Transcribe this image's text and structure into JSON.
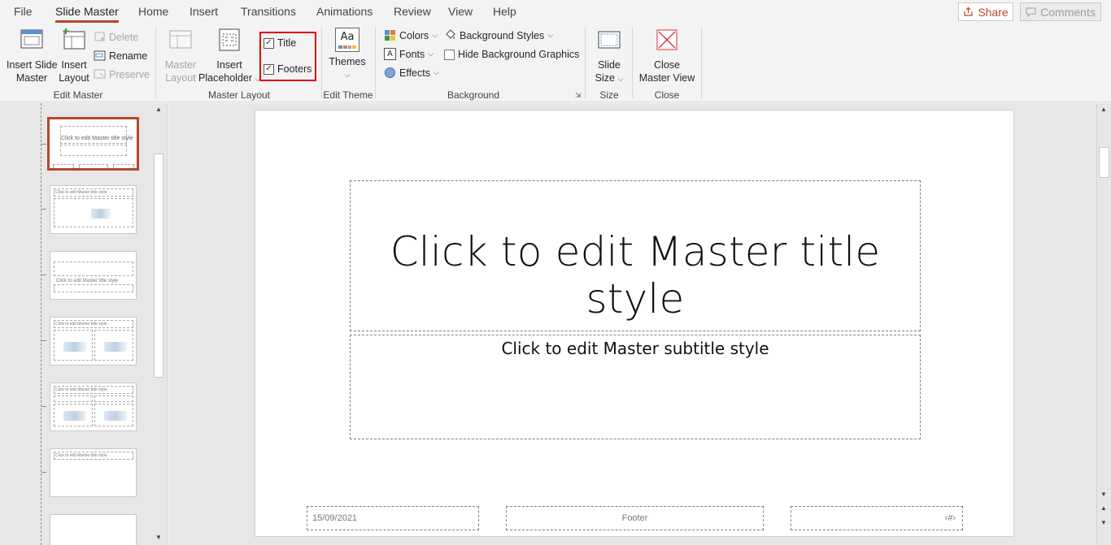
{
  "menu": {
    "tabs": [
      "File",
      "Slide Master",
      "Home",
      "Insert",
      "Transitions",
      "Animations",
      "Review",
      "View",
      "Help"
    ],
    "active_tab": "Slide Master",
    "share_label": "Share",
    "comments_label": "Comments"
  },
  "ribbon": {
    "edit_master": {
      "label": "Edit Master",
      "insert_slide_master": [
        "Insert Slide",
        "Master"
      ],
      "insert_layout": [
        "Insert",
        "Layout"
      ],
      "delete": "Delete",
      "rename": "Rename",
      "preserve": "Preserve"
    },
    "master_layout": {
      "label": "Master Layout",
      "master_layout_btn": [
        "Master",
        "Layout"
      ],
      "insert_placeholder": [
        "Insert",
        "Placeholder"
      ],
      "title_chk": "Title",
      "footers_chk": "Footers",
      "title_checked": true,
      "footers_checked": true
    },
    "edit_theme": {
      "label": "Edit Theme",
      "themes": "Themes",
      "themes_icon_text": "Aa"
    },
    "background": {
      "label": "Background",
      "colors": "Colors",
      "fonts": "Fonts",
      "effects": "Effects",
      "background_styles": "Background Styles",
      "hide_bg_graphics": "Hide Background Graphics",
      "hide_bg_checked": false
    },
    "size": {
      "label": "Size",
      "slide_size": [
        "Slide",
        "Size"
      ]
    },
    "close": {
      "label": "Close",
      "close_master_view": [
        "Close",
        "Master View"
      ]
    }
  },
  "thumbnails": {
    "master_title": "Click to edit Master title style",
    "layout_title": "Click to edit Master title style"
  },
  "slide": {
    "title": "Click to edit Master title style",
    "subtitle": "Click to edit Master subtitle style",
    "date": "15/09/2021",
    "footer": "Footer",
    "slide_number": "‹#›"
  },
  "colors": {
    "accent": "#b7472a",
    "highlight": "#e00000"
  }
}
